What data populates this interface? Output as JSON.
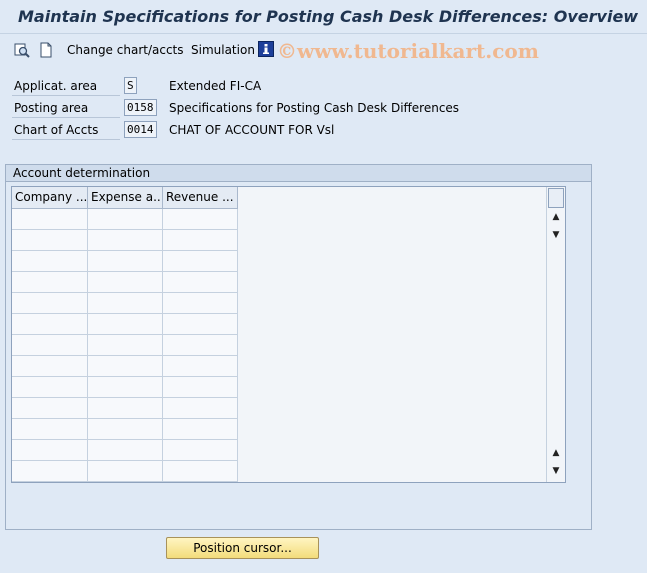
{
  "window": {
    "title": "Maintain Specifications for Posting Cash Desk Differences: Overview"
  },
  "toolbar": {
    "items": [
      {
        "label": "Change chart/accts"
      },
      {
        "label": "Simulation"
      }
    ],
    "watermark": "©www.tutorialkart.com"
  },
  "header_fields": [
    {
      "label": "Applicat. area",
      "value": "S",
      "description": "Extended FI-CA"
    },
    {
      "label": "Posting area",
      "value": "0158",
      "description": "Specifications for Posting Cash Desk Differences"
    },
    {
      "label": "Chart of Accts",
      "value": "0014",
      "description": "CHAT OF ACCOUNT FOR Vsl"
    }
  ],
  "account_determination": {
    "title": "Account determination",
    "columns": [
      "Company ...",
      "Expense a...",
      "Revenue ..."
    ]
  },
  "footer": {
    "position_button": "Position cursor..."
  },
  "colors": {
    "background": "#dfe9f5",
    "title_text": "#1f3450",
    "button_yellow": "#f3dc7b"
  }
}
